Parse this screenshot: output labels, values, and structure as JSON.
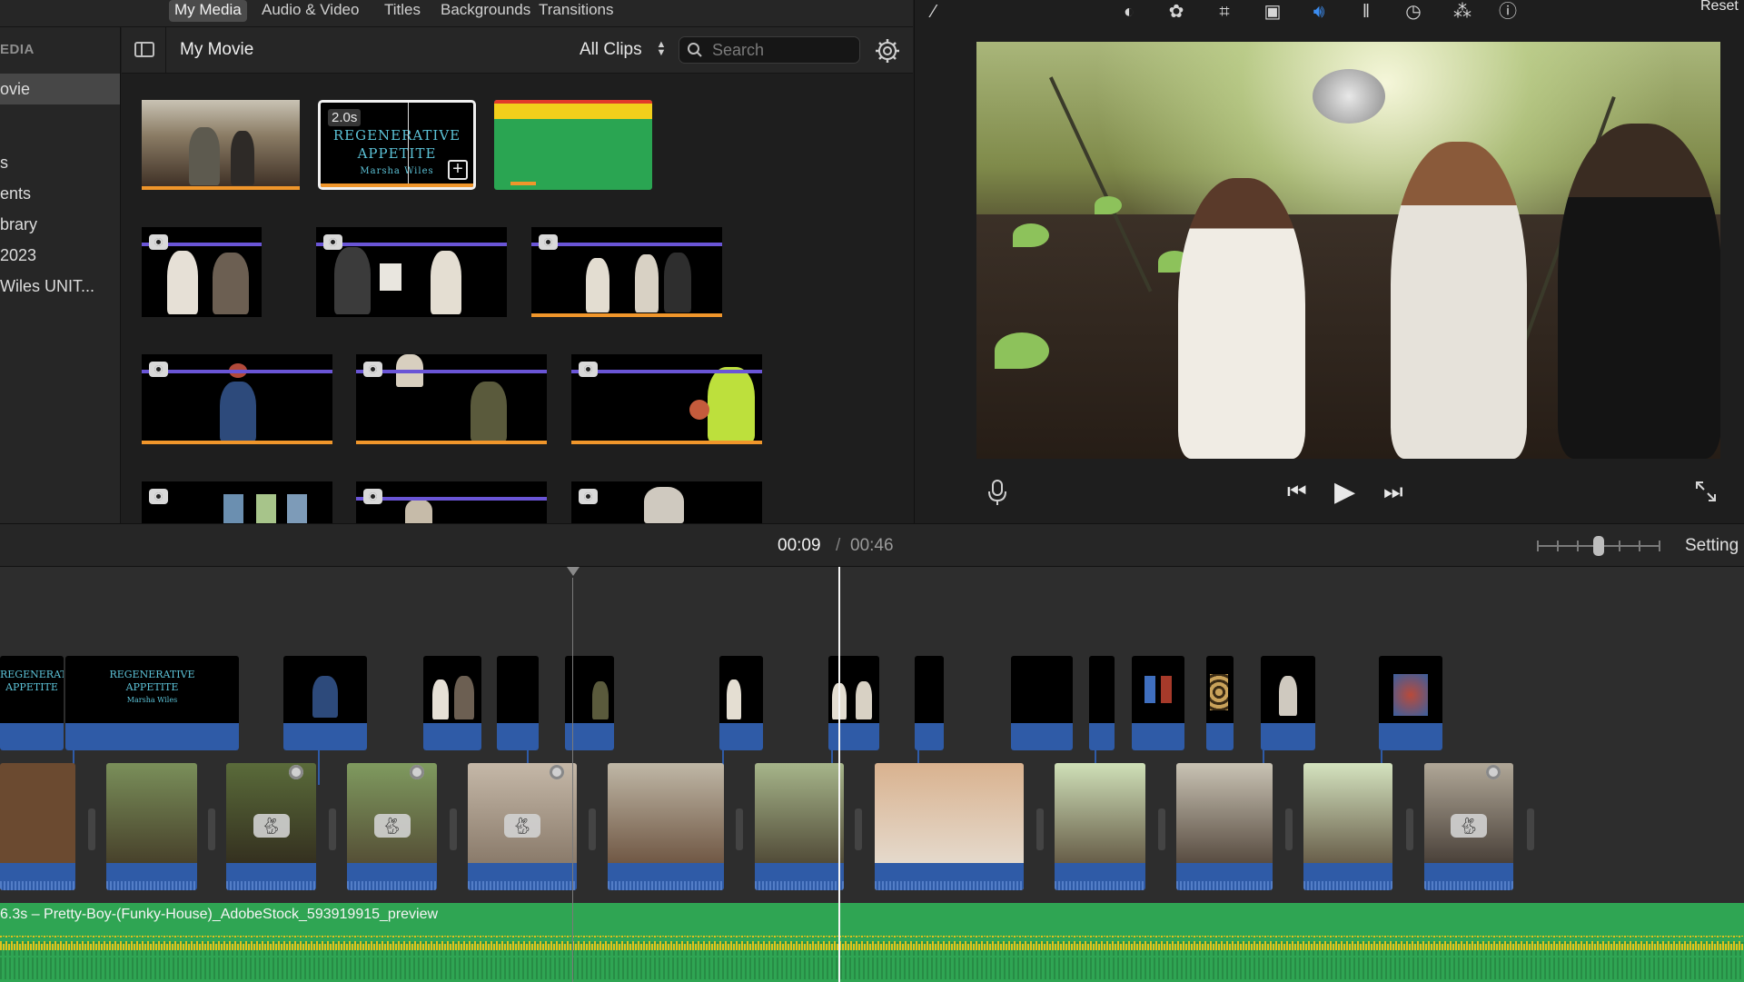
{
  "topbar": {
    "tabs": [
      {
        "label": "My Media",
        "active": true
      },
      {
        "label": "Audio & Video",
        "active": false
      },
      {
        "label": "Titles",
        "active": false
      },
      {
        "label": "Backgrounds",
        "active": false
      },
      {
        "label": "Transitions",
        "active": false
      }
    ]
  },
  "sidebar": {
    "header": "EDIA",
    "items": [
      {
        "label": "ovie",
        "selected": true
      },
      {
        "label": "s"
      },
      {
        "label": "ents"
      },
      {
        "label": "brary"
      },
      {
        "label": "2023"
      },
      {
        "label": "Wiles UNIT..."
      }
    ]
  },
  "browser": {
    "title": "My Movie",
    "filter": "All Clips",
    "search_placeholder": "Search",
    "title_clip_duration": "2.0s",
    "title_clip_text_line1": "REGENERATIVE",
    "title_clip_text_line2": "APPETITE",
    "title_clip_text_line3": "Marsha Wiles"
  },
  "viewer": {
    "reset_label": "Reset",
    "icons": [
      "magic-wand-icon",
      "color-balance-icon",
      "color-palette-icon",
      "crop-icon",
      "stabilization-icon",
      "volume-icon",
      "equalizer-icon",
      "speed-icon",
      "filter-icon",
      "info-icon"
    ]
  },
  "timeline": {
    "current_time": "00:09",
    "separator": "/",
    "total_time": "00:46",
    "settings_label": "Setting",
    "audio_clip_label": "6.3s – Pretty-Boy-(Funky-House)_AdobeStock_593919915_preview",
    "cutaway_title_line1": "REGENERATIVE",
    "cutaway_title_line2": "APPETITE",
    "cutaway_title_line3": "Marsha Wiles"
  },
  "colors": {
    "accent_blue": "#3b8cf0",
    "audio_green": "#2fa553",
    "clip_blue": "#2f5ba7",
    "favorite_orange": "#f0962b",
    "keyword_purple": "#6a55d6"
  }
}
